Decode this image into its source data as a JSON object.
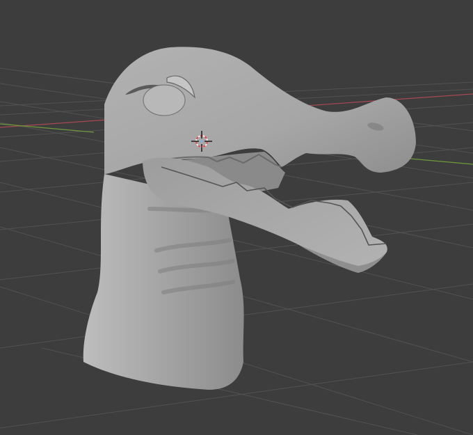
{
  "viewport": {
    "type": "3d-viewport",
    "background": "#3d3d3d",
    "grid_color": "#525252",
    "x_axis_color": "#a84a55",
    "y_axis_color": "#6f9a3c"
  },
  "model": {
    "kind": "crocodile-head-sculpt",
    "color": "#a6a6a6"
  },
  "cursor_3d": {
    "icon": "3d-cursor-icon"
  }
}
